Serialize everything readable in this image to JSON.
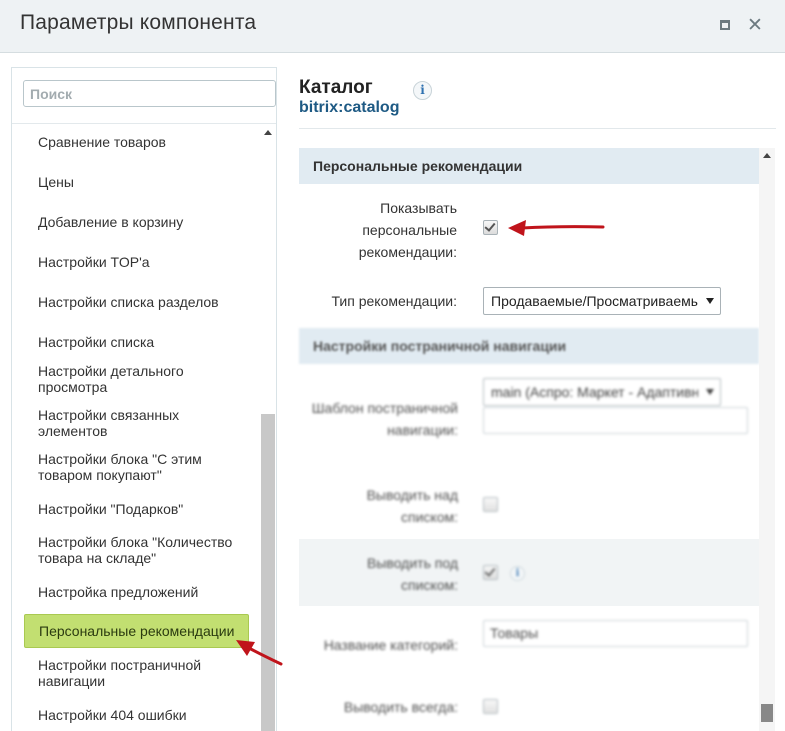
{
  "window": {
    "title": "Параметры компонента",
    "maximize_icon": "maximize-icon",
    "close_icon": "close-icon",
    "close_glyph": "✕"
  },
  "sidebar": {
    "search_placeholder": "Поиск",
    "items": [
      {
        "label": "Сравнение товаров"
      },
      {
        "label": "Цены"
      },
      {
        "label": "Добавление в корзину"
      },
      {
        "label": "Настройки TOP'a"
      },
      {
        "label": "Настройки списка разделов"
      },
      {
        "label": "Настройки списка"
      },
      {
        "label": "Настройки детального просмотра"
      },
      {
        "label": "Настройки связанных элементов"
      },
      {
        "label": "Настройки блока \"С этим товаром покупают\""
      },
      {
        "label": "Настройки \"Подарков\""
      },
      {
        "label": "Настройки блока \"Количество товара на складе\""
      },
      {
        "label": "Настройка предложений"
      },
      {
        "label": "Персональные рекомендации",
        "active": true
      },
      {
        "label": "Настройки постраничной навигации"
      },
      {
        "label": "Настройки 404 ошибки"
      }
    ],
    "active_color": "#c2df71"
  },
  "component": {
    "name": "Каталог",
    "code": "bitrix:catalog",
    "info_glyph": "i"
  },
  "sections": {
    "recommendations": {
      "title": "Персональные рекомендации",
      "show_label": "Показывать персональные рекомендации:",
      "show_checked": true,
      "type_label": "Тип рекомендации:",
      "type_value": "Продаваемые/Просматриваемые"
    },
    "pagination": {
      "title": "Настройки постраничной навигации",
      "template_label": "Шаблон постраничной навигации:",
      "template_value": "main (Аспро: Маркет - Адаптивный)",
      "show_top_label": "Выводить над списком:",
      "show_top_checked": false,
      "show_bottom_label": "Выводить под списком:",
      "show_bottom_checked": true,
      "category_label": "Название категорий:",
      "category_value": "Товары",
      "always_label": "Выводить всегда:",
      "always_checked": false
    }
  },
  "colors": {
    "accent": "#1e5a84",
    "annotation_arrow": "#c0141b",
    "section_header_bg": "#e1ebf2"
  }
}
